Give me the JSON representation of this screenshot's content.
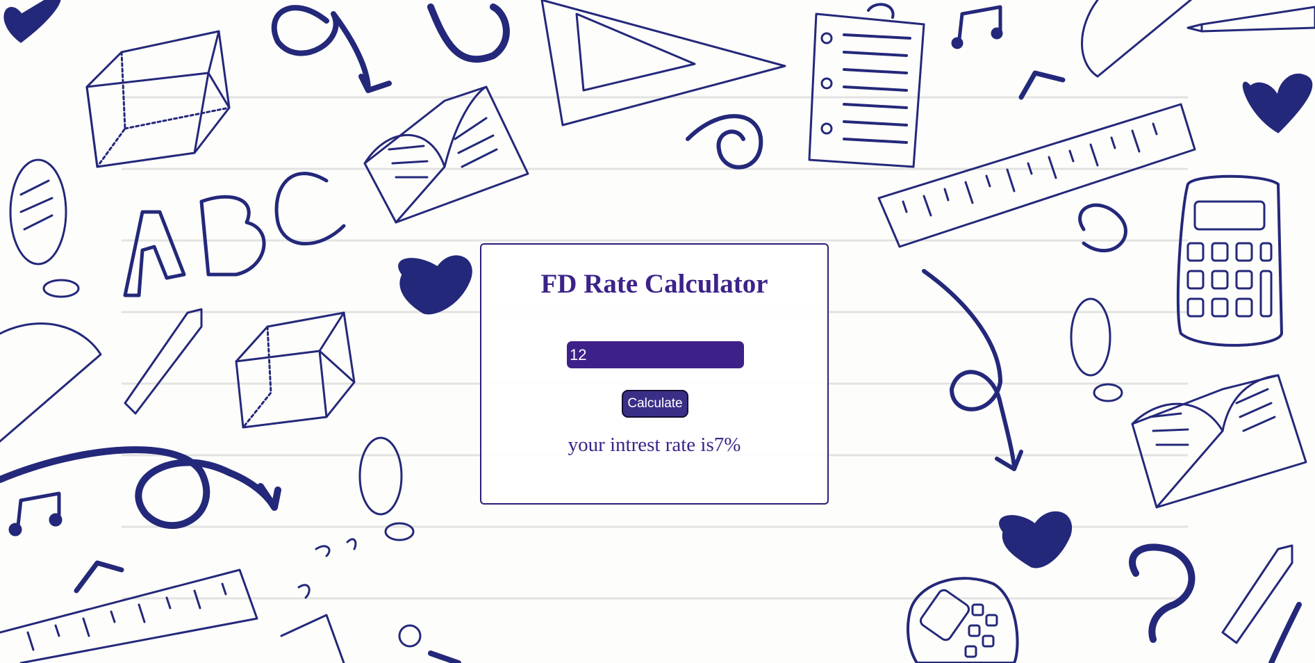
{
  "calculator": {
    "title": "FD Rate Calculator",
    "input_value": "12",
    "button_label": "Calculate",
    "result_text": "your intrest rate is7%"
  },
  "colors": {
    "accent": "#3c2389",
    "doodle": "#24287a",
    "background": "#fdfdfb"
  }
}
